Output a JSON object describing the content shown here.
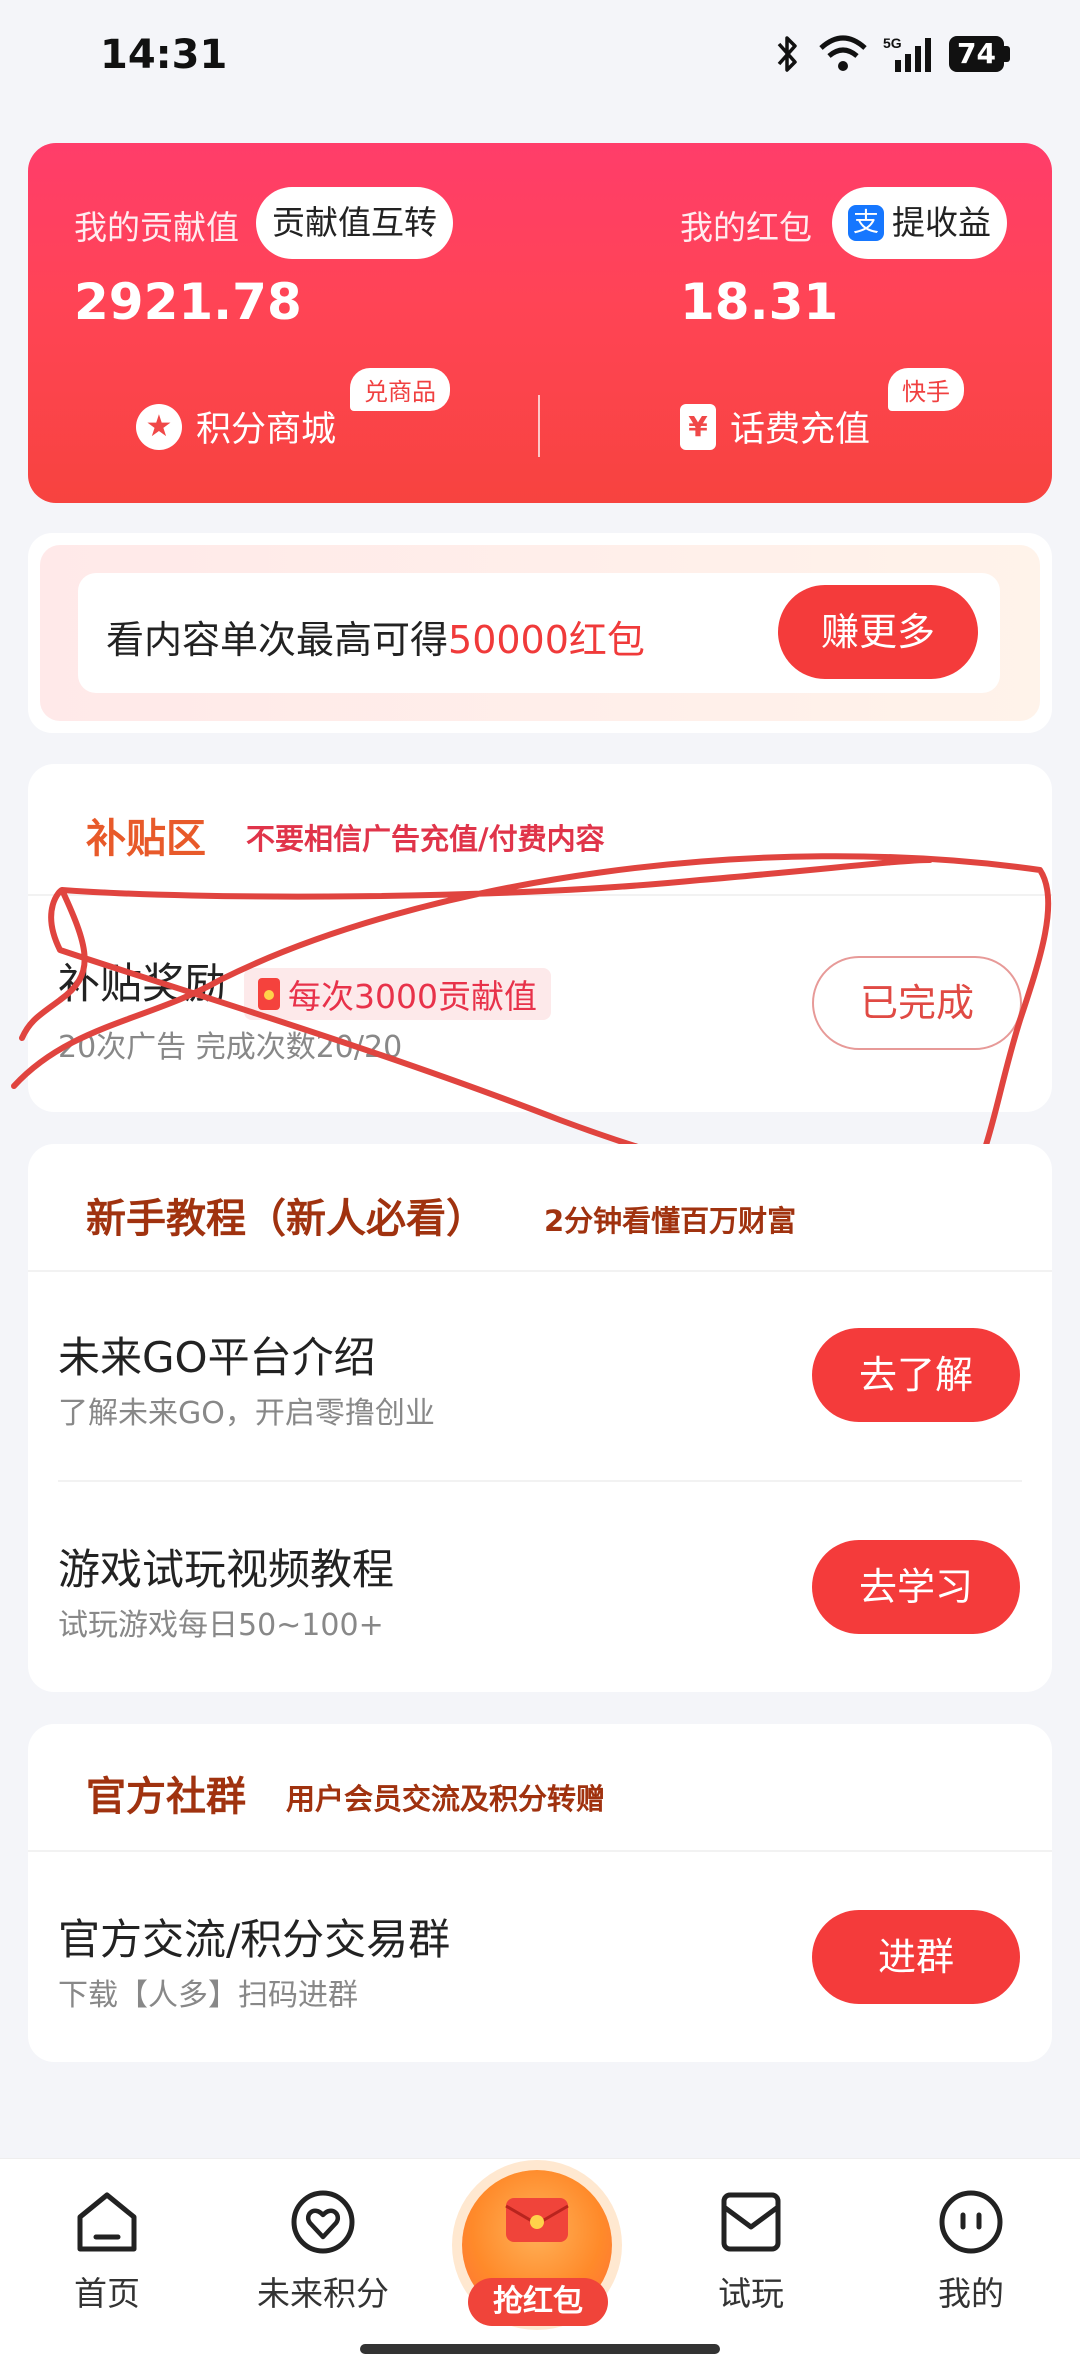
{
  "status": {
    "time": "14:31",
    "battery": "74",
    "network": "5G"
  },
  "hero": {
    "contribution_label": "我的贡献值",
    "contribution_transfer_button": "贡献值互转",
    "contribution_value": "2921.78",
    "redpacket_label": "我的红包",
    "withdraw_button": "提收益",
    "redpacket_value": "18.31",
    "mall_label": "积分商城",
    "mall_tag": "兑商品",
    "recharge_label": "话费充值",
    "recharge_tag": "快手"
  },
  "promo": {
    "text_prefix": "看内容单次最高可得",
    "text_highlight": "50000红包",
    "button": "赚更多"
  },
  "subsidy": {
    "title": "补贴区",
    "subtitle": "不要相信广告充值/付费内容",
    "item_title": "补贴奖励",
    "item_badge": "每次3000贡献值",
    "item_sub": "20次广告 完成次数20/20",
    "item_button": "已完成"
  },
  "tutorial": {
    "title": "新手教程（新人必看）",
    "subtitle": "2分钟看懂百万财富",
    "items": [
      {
        "title": "未来GO平台介绍",
        "sub": "了解未来GO，开启零撸创业",
        "button": "去了解"
      },
      {
        "title": "游戏试玩视频教程",
        "sub": "试玩游戏每日50~100+",
        "button": "去学习"
      }
    ]
  },
  "community": {
    "title": "官方社群",
    "subtitle": "用户会员交流及积分转赠",
    "item_title": "官方交流/积分交易群",
    "item_sub": "下载【人多】扫码进群",
    "item_button": "进群"
  },
  "nav": {
    "home": "首页",
    "points": "未来积分",
    "grab": "抢红包",
    "trial": "试玩",
    "mine": "我的"
  },
  "colors": {
    "brand_red": "#f43b3b",
    "section_title": "#a0320f"
  }
}
